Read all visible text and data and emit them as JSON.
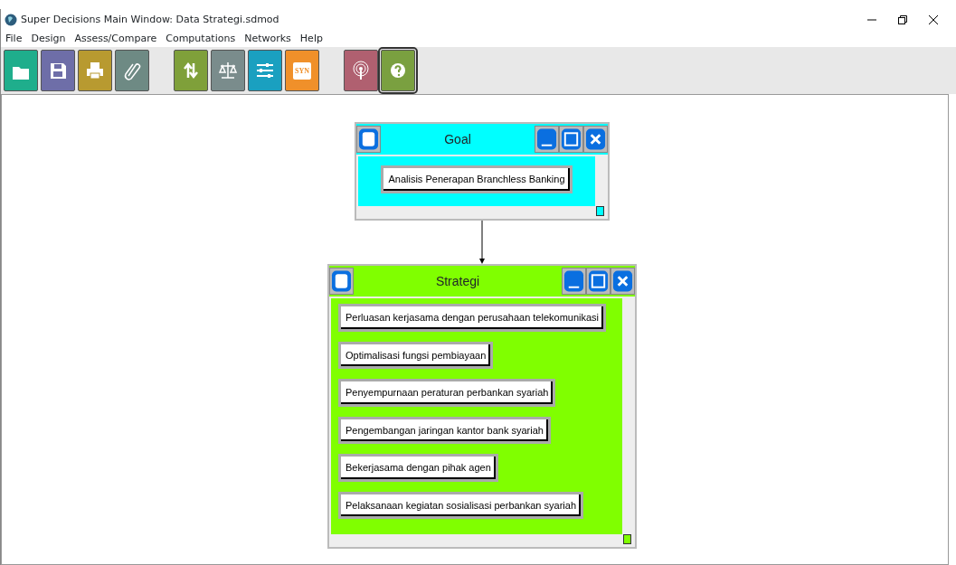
{
  "window": {
    "title": "Super Decisions Main Window: Data Strategi.sdmod"
  },
  "menu": [
    "File",
    "Design",
    "Assess/Compare",
    "Computations",
    "Networks",
    "Help"
  ],
  "toolbar": [
    {
      "kind": "folder",
      "color": "#1fae8c",
      "selected": false
    },
    {
      "kind": "save",
      "color": "#6e6ea8",
      "selected": false
    },
    {
      "kind": "print",
      "color": "#b89a30",
      "selected": false
    },
    {
      "kind": "clip",
      "color": "#6e8a84",
      "selected": false
    },
    {
      "kind": "gap"
    },
    {
      "kind": "arrows",
      "color": "#7fa03a",
      "selected": false
    },
    {
      "kind": "scale",
      "color": "#7a8c8c",
      "selected": false
    },
    {
      "kind": "sliders",
      "color": "#1aa0c0",
      "selected": false
    },
    {
      "kind": "syn",
      "color": "#f0902a",
      "selected": false,
      "label": "SYN"
    },
    {
      "kind": "gap"
    },
    {
      "kind": "broadcast",
      "color": "#b06070",
      "selected": false
    },
    {
      "kind": "help",
      "color": "#7aa040",
      "selected": true
    }
  ],
  "clusters": [
    {
      "title": "Goal",
      "color": "#00ffff",
      "arrow_to_next": true,
      "nodes": [
        "Analisis Penerapan Branchless Banking"
      ]
    },
    {
      "title": "Strategi",
      "color": "#80ff00",
      "nodes": [
        "Perluasan kerjasama dengan perusahaan telekomunikasi",
        "Optimalisasi fungsi pembiayaan",
        "Penyempurnaan peraturan perbankan syariah",
        "Pengembangan jaringan kantor bank syariah",
        "Bekerjasama dengan pihak agen",
        "Pelaksanaan kegiatan sosialisasi perbankan syariah"
      ]
    }
  ]
}
